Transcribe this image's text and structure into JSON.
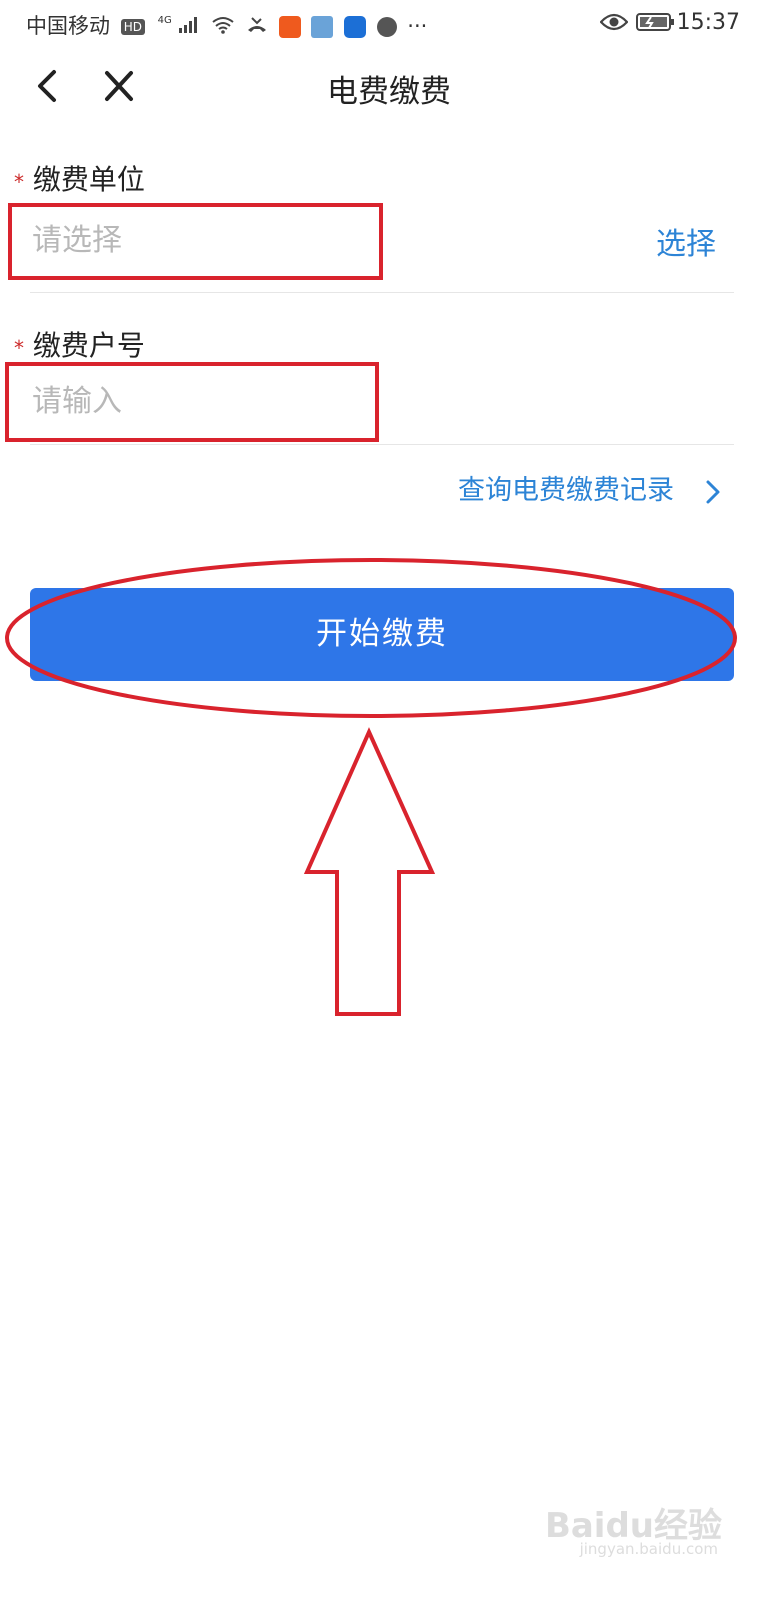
{
  "status_bar": {
    "carrier": "中国移动",
    "hd": "HD",
    "network": "4G",
    "time": "15:37",
    "more": "···"
  },
  "nav": {
    "title": "电费缴费"
  },
  "form": {
    "required_mark": "*",
    "unit": {
      "label": "缴费单位",
      "placeholder": "请选择",
      "value": "",
      "action": "选择"
    },
    "account": {
      "label": "缴费户号",
      "placeholder": "请输入",
      "value": ""
    },
    "record_link": "查询电费缴费记录",
    "record_chevron": "chevron-right-icon"
  },
  "submit": {
    "label": "开始缴费"
  },
  "watermark": {
    "text": "Baidu经验",
    "sub": "jingyan.baidu.com"
  },
  "colors": {
    "primary": "#2e76e8",
    "link": "#2d84d6",
    "required": "#cc2a2a",
    "annotation": "#d9232d"
  }
}
